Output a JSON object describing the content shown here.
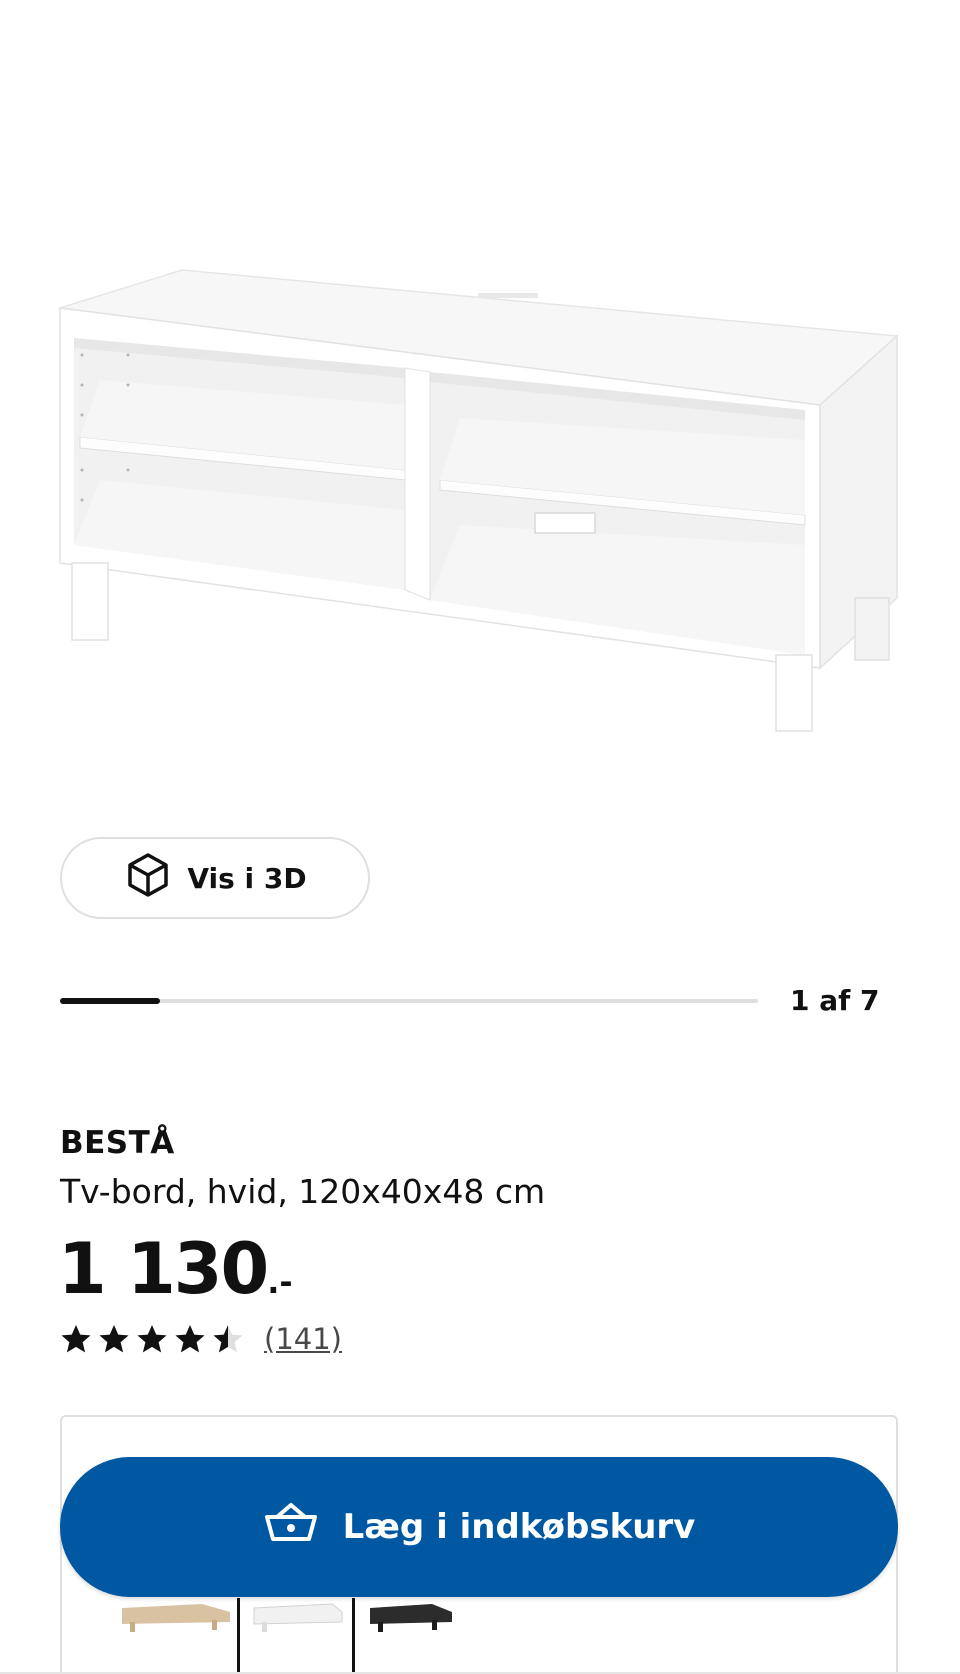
{
  "gallery": {
    "view_3d_label": "Vis i 3D",
    "counter": "1 af 7",
    "progress": 0.143
  },
  "product": {
    "name": "BESTÅ",
    "description": "Tv-bord, hvid, 120x40x48 cm",
    "price_main": "1 130",
    "price_suffix": ".-",
    "rating": 4.5,
    "review_count": "(141)"
  },
  "cart": {
    "add_label": "Læg i indkøbskurv"
  },
  "colors": {
    "accent": "#0058a3",
    "text": "#111111",
    "border": "#dfdfdf"
  },
  "icons": [
    "cube-3d-icon",
    "star-icon",
    "half-star-icon",
    "basket-icon"
  ]
}
